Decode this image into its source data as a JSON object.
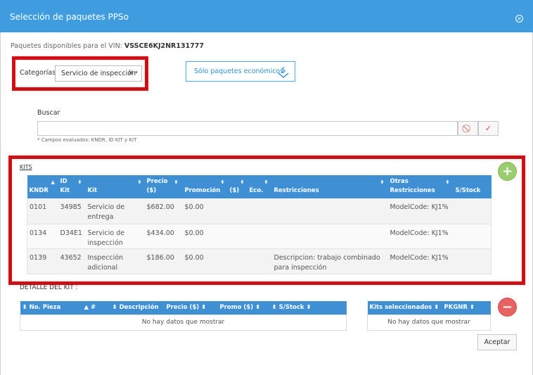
{
  "dialog": {
    "title": "Selección de paquetes PPSo",
    "close_icon": "close-circle-icon"
  },
  "vin": {
    "label": "Paquetes disponibles para el VIN:",
    "value": "VSSCE6KJ2NR131777"
  },
  "categorias": {
    "label": "Categorías",
    "selected": "Servicio de inspección",
    "clear": "×",
    "caret": "▾"
  },
  "eco_button": {
    "label": "Sólo paquetes económicos",
    "icon": "dollar-down-icon"
  },
  "buscar": {
    "label": "Buscar",
    "value": "",
    "placeholder": "",
    "hint": "* Campos evaluados: KNDR, ID KIT y KIT",
    "clear_icon": "⃠",
    "confirm_icon": "✓"
  },
  "kits": {
    "title": "KITS",
    "add_label": "+",
    "columns": [
      {
        "line1": "",
        "line2": "KNDR"
      },
      {
        "line1": "ID",
        "line2": "Kit"
      },
      {
        "line1": "",
        "line2": "Kit"
      },
      {
        "line1": "Precio",
        "line2": "($)"
      },
      {
        "line1": "",
        "line2": "Promoción"
      },
      {
        "line1": "",
        "line2": "($)"
      },
      {
        "line1": "",
        "line2": "Eco."
      },
      {
        "line1": "",
        "line2": "Restricciones"
      },
      {
        "line1": "Otras",
        "line2": "Restricciones"
      },
      {
        "line1": "",
        "line2": "S/Stock"
      }
    ],
    "rows": [
      {
        "kndr": "0101",
        "id": "34985",
        "kit": "Servicio de entrega",
        "precio": "$682.00",
        "promo": "$0.00",
        "promo_usd": "",
        "eco": "",
        "restricciones": "",
        "otras": "ModelCode: KJ1%",
        "stock": ""
      },
      {
        "kndr": "0134",
        "id": "D34E1",
        "kit": "Servicio de inspección",
        "precio": "$434.00",
        "promo": "$0.00",
        "promo_usd": "",
        "eco": "",
        "restricciones": "",
        "otras": "ModelCode: KJ1%",
        "stock": ""
      },
      {
        "kndr": "0139",
        "id": "43652",
        "kit": "Inspección adicional",
        "precio": "$186.00",
        "promo": "$0.00",
        "promo_usd": "",
        "eco": "",
        "restricciones": "Descripcion: trabajo combinado para inspección",
        "otras": "ModelCode: KJ1%",
        "stock": ""
      }
    ]
  },
  "detalle": {
    "title": "DETALLE DEL KIT :",
    "columns": [
      "No. Pieza",
      "#",
      "Descripción",
      "Precio ($)",
      "Promo ($)",
      "S/Stock"
    ],
    "empty": "No hay datos que mostrar"
  },
  "seleccionados": {
    "columns": [
      "Kits seleccionados",
      "PKGNR"
    ],
    "empty": "No hay datos que mostrar",
    "remove_label": "−"
  },
  "aceptar_label": "Aceptar",
  "colors": {
    "header": "#3f9ddf",
    "table_header": "#3f8fd4",
    "highlight": "#d40d12",
    "add": "#9acd6e",
    "remove": "#e86262"
  }
}
